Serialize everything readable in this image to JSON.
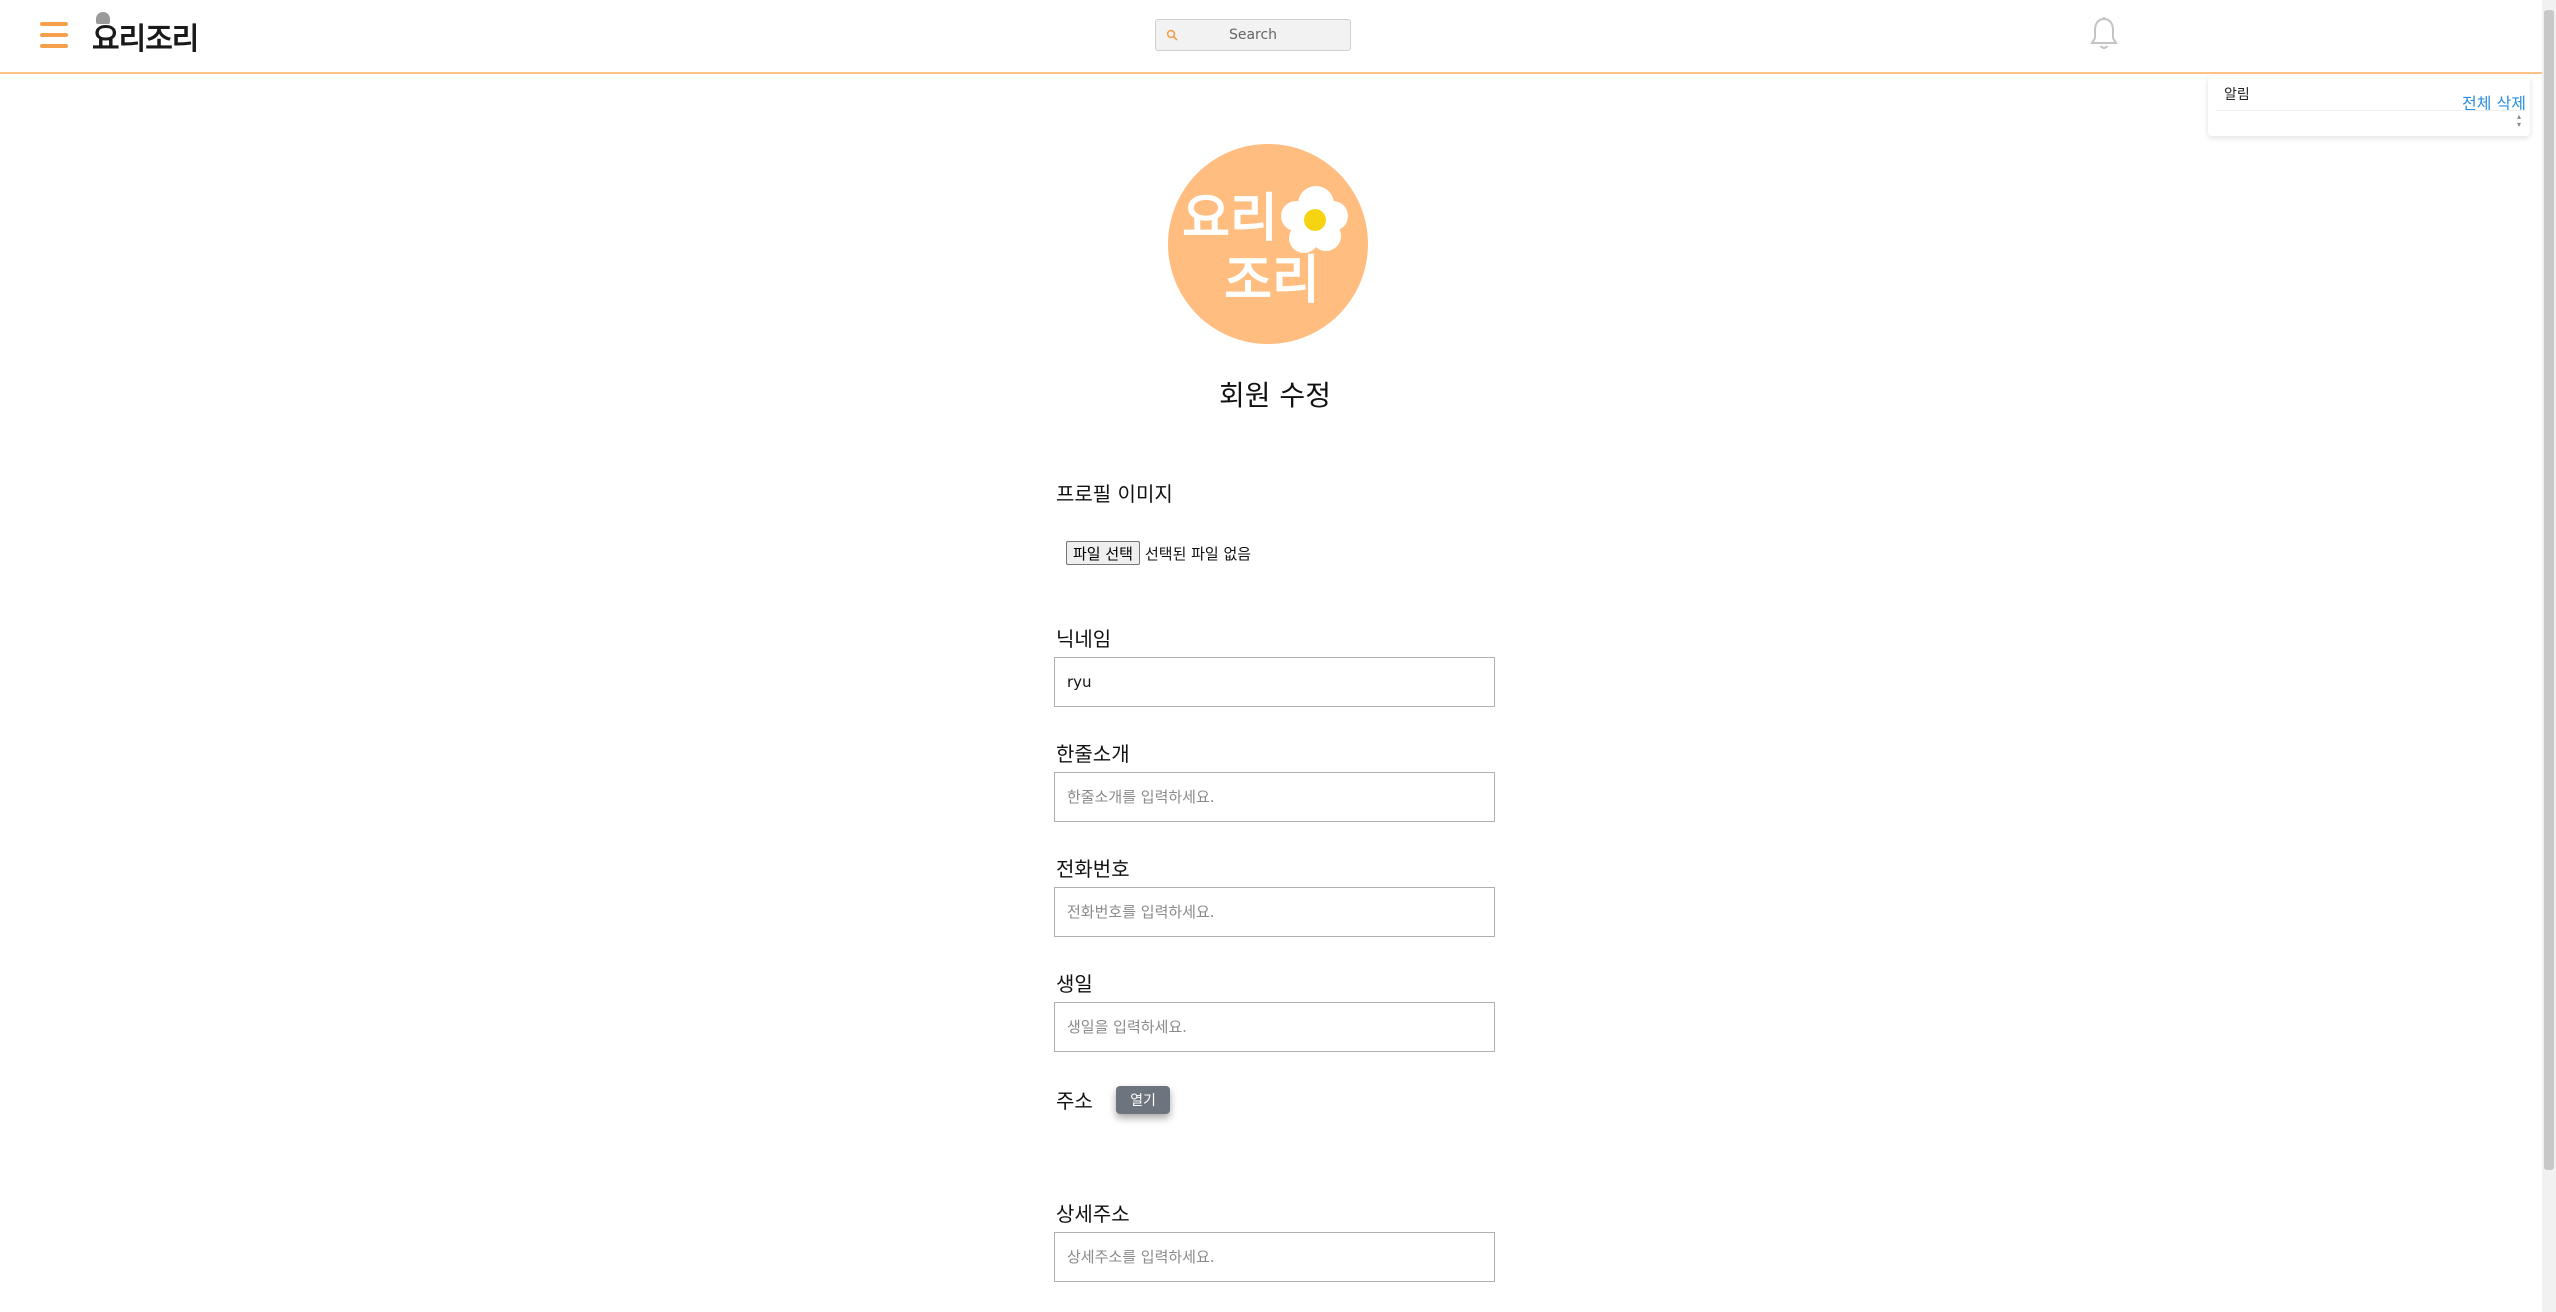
{
  "header": {
    "logo_text": "요리조리",
    "search": {
      "placeholder": "Search"
    }
  },
  "notifications": {
    "title": "알림",
    "clear_all_label": "전체 삭제"
  },
  "avatar": {
    "line1": "요리",
    "line2": "조리"
  },
  "page": {
    "title": "회원 수정"
  },
  "form": {
    "profile_image": {
      "label": "프로필 이미지",
      "button_label": "파일 선택",
      "status": "선택된 파일 없음"
    },
    "nickname": {
      "label": "닉네임",
      "value": "ryu"
    },
    "intro": {
      "label": "한줄소개",
      "placeholder": "한줄소개를 입력하세요."
    },
    "phone": {
      "label": "전화번호",
      "placeholder": "전화번호를 입력하세요."
    },
    "birthday": {
      "label": "생일",
      "placeholder": "생일을 입력하세요."
    },
    "address": {
      "label": "주소",
      "open_label": "열기"
    },
    "detail_address": {
      "label": "상세주소",
      "placeholder": "상세주소를 입력하세요."
    }
  },
  "colors": {
    "accent": "#f5a04a",
    "avatar_bg": "#ffbd80",
    "link": "#2a8fe0",
    "secondary_button": "#6c757d"
  },
  "icons": {
    "menu": "hamburger-menu-icon",
    "search": "search-icon",
    "notifications": "bell-icon"
  }
}
